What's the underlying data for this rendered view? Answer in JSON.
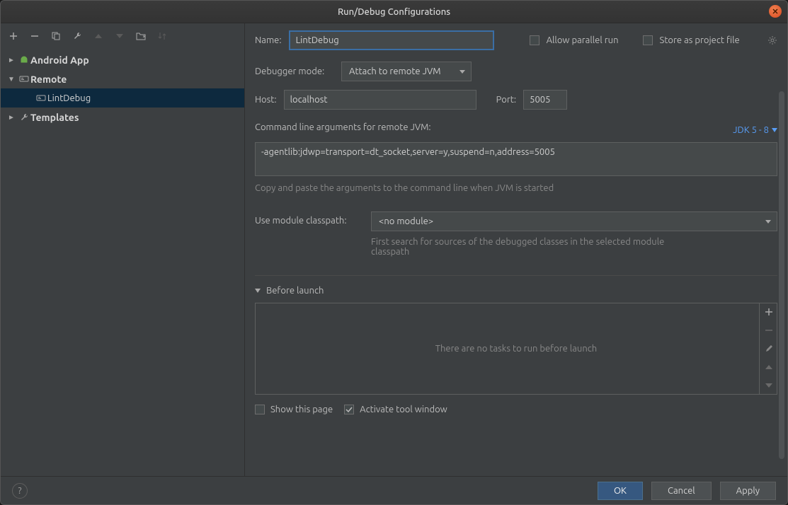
{
  "title": "Run/Debug Configurations",
  "tree": {
    "android_app": "Android App",
    "remote": "Remote",
    "lintdebug": "LintDebug",
    "templates": "Templates"
  },
  "form": {
    "name_label": "Name:",
    "name_value": "LintDebug",
    "allow_parallel": "Allow parallel run",
    "store_project": "Store as project file",
    "debugger_mode_label": "Debugger mode:",
    "debugger_mode_value": "Attach to remote JVM",
    "host_label": "Host:",
    "host_value": "localhost",
    "port_label": "Port:",
    "port_value": "5005",
    "cmdline_label": "Command line arguments for remote JVM:",
    "jdk_link": "JDK 5 - 8",
    "cmdline_value": "-agentlib:jdwp=transport=dt_socket,server=y,suspend=n,address=5005",
    "cmdline_hint": "Copy and paste the arguments to the command line when JVM is started",
    "module_label": "Use module classpath:",
    "module_value": "<no module>",
    "module_hint": "First search for sources of the debugged classes in the selected module classpath",
    "before_launch": "Before launch",
    "no_tasks": "There are no tasks to run before launch",
    "show_page": "Show this page",
    "activate_tool": "Activate tool window"
  },
  "buttons": {
    "ok": "OK",
    "cancel": "Cancel",
    "apply": "Apply"
  }
}
